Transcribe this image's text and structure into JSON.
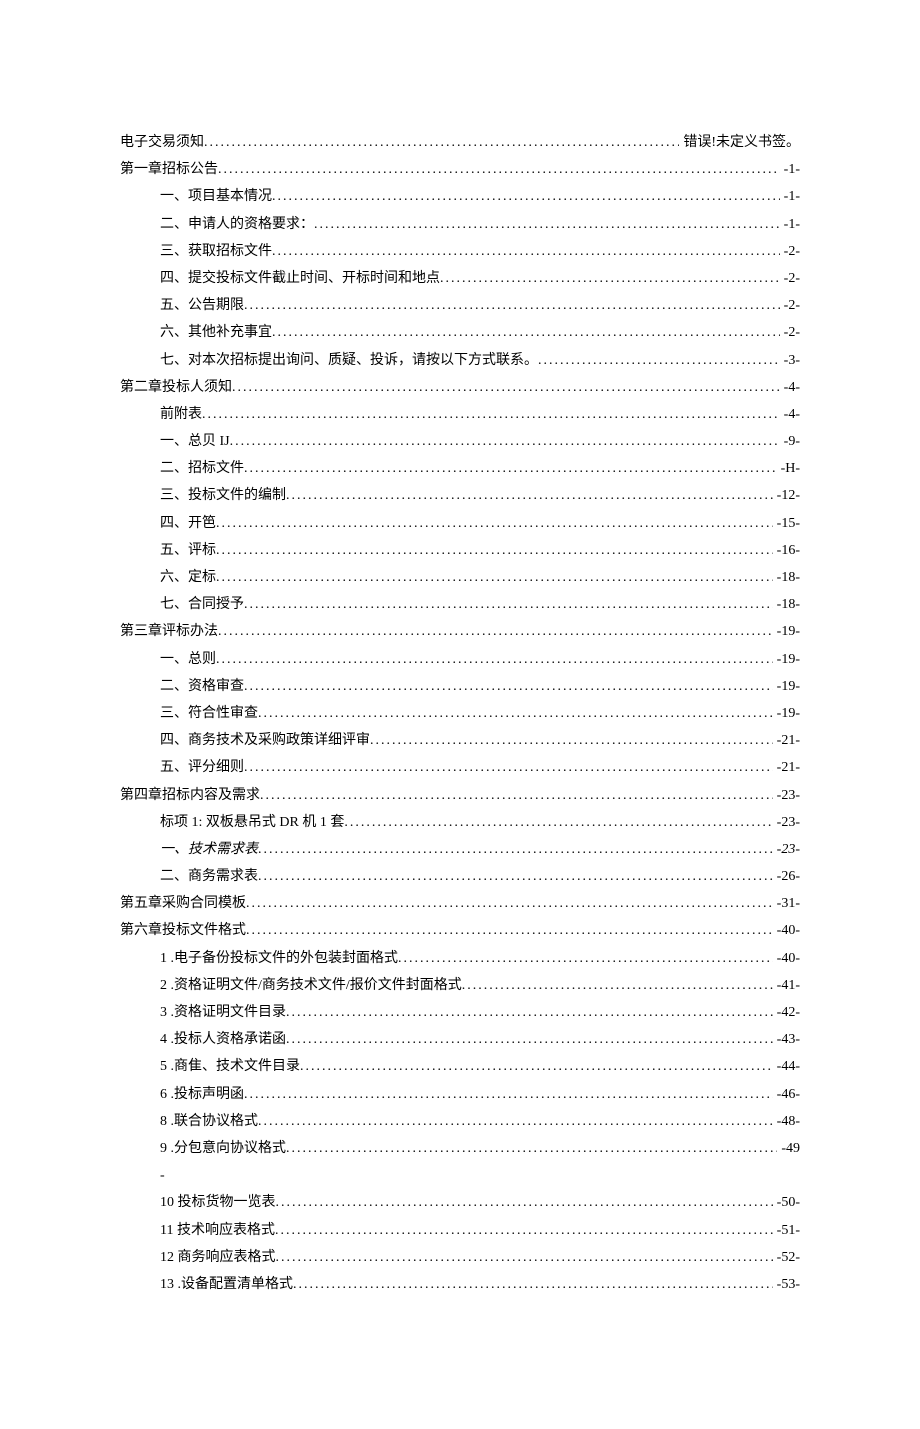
{
  "toc": [
    {
      "indent": 0,
      "label": "电子交易须知",
      "page": "错误!未定义书签。"
    },
    {
      "indent": 0,
      "label": "第一章招标公告",
      "page": "-1-"
    },
    {
      "indent": 1,
      "label": "一、项目基本情况",
      "page": "-1-"
    },
    {
      "indent": 1,
      "label": "二、申请人的资格要求：",
      "page": "-1-"
    },
    {
      "indent": 1,
      "label": "三、获取招标文件",
      "page": "-2-"
    },
    {
      "indent": 1,
      "label": "四、提交投标文件截止时间、开标时间和地点",
      "page": "-2-"
    },
    {
      "indent": 1,
      "label": "五、公告期限",
      "page": "-2-"
    },
    {
      "indent": 1,
      "label": "六、其他补充事宜",
      "page": "-2-"
    },
    {
      "indent": 1,
      "label": "七、对本次招标提出询问、质疑、投诉，请按以下方式联系。",
      "page": "-3-"
    },
    {
      "indent": 0,
      "label": "第二章投标人须知",
      "page": "-4-"
    },
    {
      "indent": 1,
      "label": "前附表",
      "page": "-4-"
    },
    {
      "indent": 1,
      "label": "一、总贝 IJ",
      "page": "-9-"
    },
    {
      "indent": 1,
      "label": "二、招标文件",
      "page": "-H-"
    },
    {
      "indent": 1,
      "label": "三、投标文件的编制",
      "page": "-12-"
    },
    {
      "indent": 1,
      "label": "四、开笆",
      "page": "-15-"
    },
    {
      "indent": 1,
      "label": "五、评标",
      "page": "-16-"
    },
    {
      "indent": 1,
      "label": "六、定标",
      "page": "-18-"
    },
    {
      "indent": 1,
      "label": "七、合同授予",
      "page": "-18-"
    },
    {
      "indent": 0,
      "label": "第三章评标办法",
      "page": "-19-"
    },
    {
      "indent": 1,
      "label": "一、总则",
      "page": "-19-"
    },
    {
      "indent": 1,
      "label": "二、资格审查",
      "page": "-19-"
    },
    {
      "indent": 1,
      "label": "三、符合性审查",
      "page": "-19-"
    },
    {
      "indent": 1,
      "label": "四、商务技术及采购政策详细评审",
      "page": "-21-"
    },
    {
      "indent": 1,
      "label": "五、评分细则",
      "page": "-21-"
    },
    {
      "indent": 0,
      "label": "第四章招标内容及需求",
      "page": "-23-"
    },
    {
      "indent": 1,
      "label": "标项 1: 双板悬吊式 DR 机 1 套",
      "page": "-23-"
    },
    {
      "indent": 1,
      "label": "一、技术需求表",
      "page": "-23-",
      "italic": true
    },
    {
      "indent": 1,
      "label": "二、商务需求表",
      "page": "-26-"
    },
    {
      "indent": 0,
      "label": "第五章采购合同模板",
      "page": "-31-"
    },
    {
      "indent": 0,
      "label": "第六章投标文件格式",
      "page": "-40-"
    },
    {
      "indent": 1,
      "label": "1  .电子备份投标文件的外包装封面格式",
      "page": "-40-"
    },
    {
      "indent": 1,
      "label": "2  .资格证明文件/商务技术文件/报价文件封面格式",
      "page": "-41-"
    },
    {
      "indent": 1,
      "label": "3  .资格证明文件目录",
      "page": "-42-"
    },
    {
      "indent": 1,
      "label": "4  .投标人资格承诺函",
      "page": "-43-"
    },
    {
      "indent": 1,
      "label": "5  .商隹、技术文件目录",
      "page": "-44-"
    },
    {
      "indent": 1,
      "label": "6  .投标声明函",
      "page": "-46-"
    },
    {
      "indent": 1,
      "label": "8  .联合协议格式",
      "page": "-48-"
    },
    {
      "indent": 1,
      "label": "9  .分包意向协议格式",
      "page": "-49"
    },
    {
      "indent": 1,
      "label": "-",
      "page": "",
      "noleader": true
    },
    {
      "indent": 1,
      "label": "10  投标货物一览表",
      "page": "-50-"
    },
    {
      "indent": 1,
      "label": "11  技术响应表格式",
      "page": "-51-"
    },
    {
      "indent": 1,
      "label": "12  商务响应表格式",
      "page": "-52-"
    },
    {
      "indent": 1,
      "label": "13  .设备配置清单格式",
      "page": "-53-"
    }
  ]
}
